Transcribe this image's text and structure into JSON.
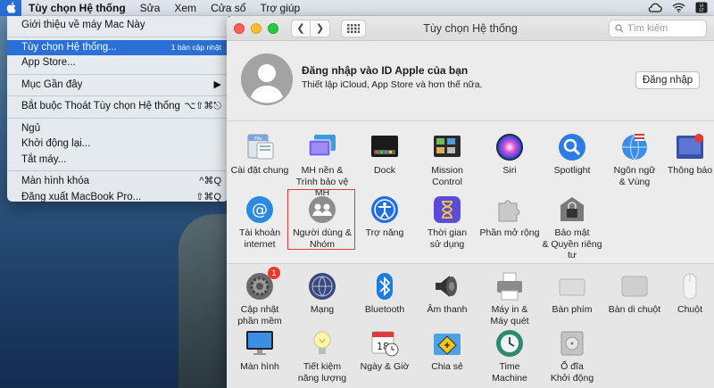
{
  "menubar": {
    "app_name": "Tùy chọn Hệ thống",
    "items": [
      "Sửa",
      "Xem",
      "Cửa sổ",
      "Trợ giúp"
    ]
  },
  "apple_menu": {
    "items": [
      {
        "label": "Giới thiệu về máy Mac Này",
        "shortcut": ""
      },
      {
        "label": "Tùy chọn Hệ thống...",
        "badge": "1 bản cập nhật",
        "selected": true
      },
      {
        "label": "App Store...",
        "shortcut": ""
      },
      {
        "label": "Mục Gần đây",
        "shortcut": "▶"
      },
      {
        "label": "Bắt buộc Thoát Tùy chọn Hệ thống",
        "shortcut": "⌥⇧⌘⎋"
      },
      {
        "label": "Ngủ",
        "shortcut": ""
      },
      {
        "label": "Khởi động lại...",
        "shortcut": ""
      },
      {
        "label": "Tắt máy...",
        "shortcut": ""
      },
      {
        "label": "Màn hình khóa",
        "shortcut": "^⌘Q"
      },
      {
        "label": "Đăng xuất MacBook Pro...",
        "shortcut": "⇧⌘Q"
      }
    ]
  },
  "window": {
    "title": "Tùy chọn Hệ thống",
    "search_placeholder": "Tìm kiếm"
  },
  "account": {
    "title": "Đăng nhập vào ID Apple của bạn",
    "subtitle": "Thiết lập iCloud, App Store và hơn thế nữa.",
    "login_button": "Đăng nhập"
  },
  "panes_top": [
    {
      "label": "Cài đặt chung",
      "icon": "general-icon"
    },
    {
      "label": "MH nền &\nTrình bảo vệ MH",
      "icon": "desktop-screensaver-icon"
    },
    {
      "label": "Dock",
      "icon": "dock-icon"
    },
    {
      "label": "Mission\nControl",
      "icon": "mission-control-icon"
    },
    {
      "label": "Siri",
      "icon": "siri-icon"
    },
    {
      "label": "Spotlight",
      "icon": "spotlight-icon"
    },
    {
      "label": "Ngôn ngữ\n& Vùng",
      "icon": "language-region-icon"
    },
    {
      "label": "Thông báo",
      "icon": "notifications-icon"
    },
    {
      "label": "Tài khoản\ninternet",
      "icon": "internet-accounts-icon"
    },
    {
      "label": "Người dùng &\nNhóm",
      "icon": "users-groups-icon"
    },
    {
      "label": "Trợ năng",
      "icon": "accessibility-icon"
    },
    {
      "label": "Thời gian\nsử dụng",
      "icon": "screen-time-icon"
    },
    {
      "label": "Phần mở rộng",
      "icon": "extensions-icon"
    },
    {
      "label": "Bảo mật\n& Quyền riêng tư",
      "icon": "security-privacy-icon"
    }
  ],
  "panes_bottom": [
    {
      "label": "Cập nhật\nphần mềm",
      "icon": "software-update-icon",
      "badge": "1"
    },
    {
      "label": "Mạng",
      "icon": "network-icon"
    },
    {
      "label": "Bluetooth",
      "icon": "bluetooth-icon"
    },
    {
      "label": "Âm thanh",
      "icon": "sound-icon"
    },
    {
      "label": "Máy in &\nMáy quét",
      "icon": "printers-scanners-icon"
    },
    {
      "label": "Bàn phím",
      "icon": "keyboard-icon"
    },
    {
      "label": "Bàn di chuột",
      "icon": "trackpad-icon"
    },
    {
      "label": "Chuột",
      "icon": "mouse-icon"
    },
    {
      "label": "Màn hình",
      "icon": "displays-icon"
    },
    {
      "label": "Tiết kiệm\nnăng lượng",
      "icon": "energy-saver-icon"
    },
    {
      "label": "Ngày & Giờ",
      "icon": "date-time-icon"
    },
    {
      "label": "Chia sẻ",
      "icon": "sharing-icon"
    },
    {
      "label": "Time\nMachine",
      "icon": "time-machine-icon"
    },
    {
      "label": "Ổ đĩa\nKhởi động",
      "icon": "startup-disk-icon"
    }
  ],
  "colors": {
    "selection": "#2a6fd6",
    "highlight": "#e03a3a",
    "badge": "#e63b2e"
  }
}
